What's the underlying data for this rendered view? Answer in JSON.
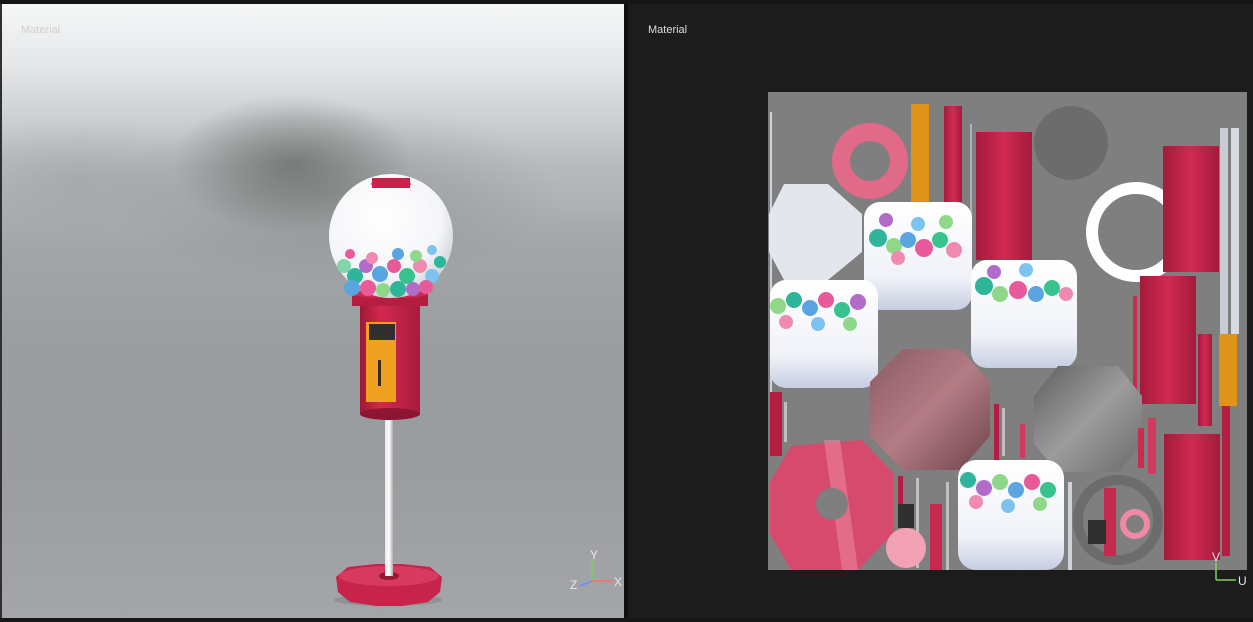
{
  "viewport_3d": {
    "label": "Material",
    "axes": {
      "up": "Y",
      "right": "X",
      "depth": "Z"
    }
  },
  "uv_editor": {
    "label": "Material",
    "axes": {
      "up": "V",
      "right": "U"
    }
  },
  "colors": {
    "red": "#c4224a",
    "orange": "#f0a020",
    "uv_grid_background": "#7f7f7f",
    "panel_background": "#1c1c1c"
  },
  "icons": [
    "axis-gizmo-icon",
    "uv-axis-gizmo-icon"
  ]
}
